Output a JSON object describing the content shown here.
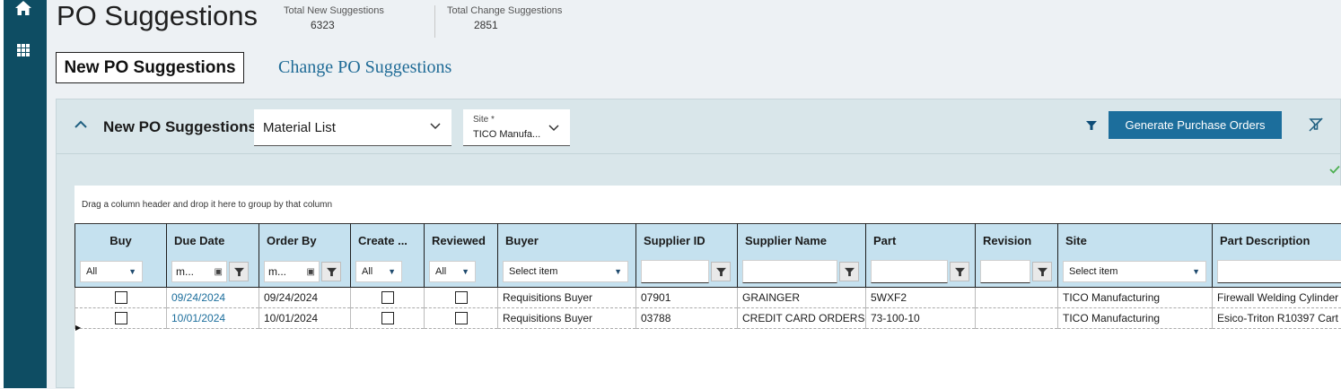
{
  "page": {
    "title": "PO Suggestions",
    "stats": [
      {
        "label": "Total New Suggestions",
        "value": "6323"
      },
      {
        "label": "Total Change Suggestions",
        "value": "2851"
      }
    ],
    "tabs": [
      {
        "label": "New PO Suggestions",
        "active": true
      },
      {
        "label": "Change PO Suggestions",
        "active": false
      }
    ]
  },
  "panel": {
    "title": "New PO Suggestions",
    "material_select": "Material List",
    "site_select": {
      "label": "Site *",
      "value": "TICO Manufa..."
    },
    "generate_button": "Generate Purchase Orders",
    "group_hint": "Drag a column header and drop it here to group by that column"
  },
  "grid": {
    "columns": [
      "Buy",
      "Due Date",
      "Order By",
      "Create ...",
      "Reviewed",
      "Buyer",
      "Supplier ID",
      "Supplier Name",
      "Part",
      "Revision",
      "Site",
      "Part Description"
    ],
    "filters": {
      "buy": "All",
      "due_date": "m...",
      "order_by": "m...",
      "create": "All",
      "reviewed": "All",
      "buyer": "Select item",
      "site": "Select item"
    },
    "rows": [
      {
        "buy": false,
        "due_date": "09/24/2024",
        "order_by": "09/24/2024",
        "create": false,
        "reviewed": false,
        "buyer": "Requisitions Buyer",
        "supplier_id": "07901",
        "supplier_name": "GRAINGER",
        "part": "5WXF2",
        "revision": "",
        "site": "TICO Manufacturing",
        "part_description": "Firewall Welding Cylinder"
      },
      {
        "buy": false,
        "due_date": "10/01/2024",
        "order_by": "10/01/2024",
        "create": false,
        "reviewed": false,
        "buyer": "Requisitions Buyer",
        "supplier_id": "03788",
        "supplier_name": "CREDIT CARD ORDERS",
        "part": "73-100-10",
        "revision": "",
        "site": "TICO Manufacturing",
        "part_description": "Esico-Triton R10397 Cart"
      }
    ]
  },
  "colors": {
    "sidebar": "#0e4d63",
    "accent": "#1c6e9c",
    "header_row": "#c5e1ef"
  }
}
